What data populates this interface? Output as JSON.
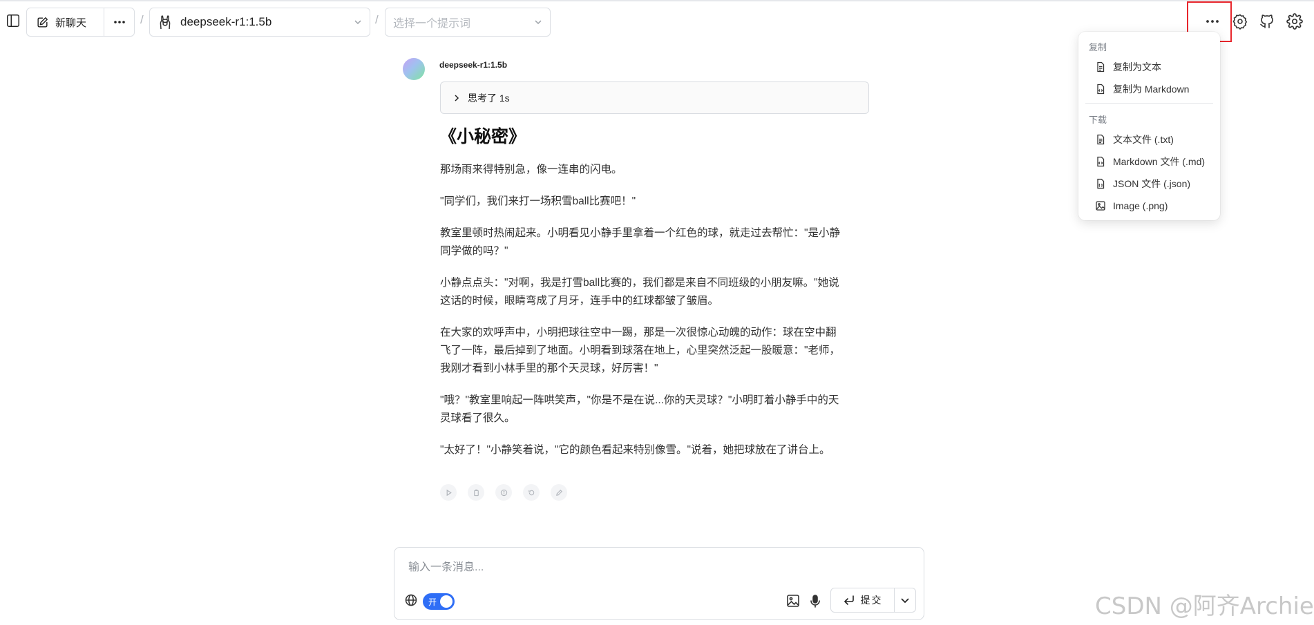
{
  "header": {
    "new_chat_label": "新聊天",
    "separator": "/",
    "model": "deepseek-r1:1.5b",
    "prompt_placeholder": "选择一个提示词"
  },
  "message": {
    "sender": "deepseek-r1:1.5b",
    "thinking_label": "思考了 1s",
    "title": "《小秘密》",
    "paragraphs": [
      "那场雨来得特别急，像一连串的闪电。",
      "\"同学们，我们来打一场积雪ball比赛吧！\"",
      "教室里顿时热闹起来。小明看见小静手里拿着一个红色的球，就走过去帮忙：\"是小静同学做的吗？\"",
      "小静点点头：\"对啊，我是打雪ball比赛的，我们都是来自不同班级的小朋友嘛。\"她说这话的时候，眼睛弯成了月牙，连手中的红球都皱了皱眉。",
      "在大家的欢呼声中，小明把球往空中一踢，那是一次很惊心动魄的动作：球在空中翻飞了一阵，最后掉到了地面。小明看到球落在地上，心里突然泛起一股暖意：\"老师，我刚才看到小林手里的那个天灵球，好厉害！\"",
      "\"哦？\"教室里响起一阵哄笑声，\"你是不是在说...你的天灵球？\"小明盯着小静手中的天灵球看了很久。",
      "\"太好了！\"小静笑着说，\"它的颜色看起来特别像雪。\"说着，她把球放在了讲台上。"
    ]
  },
  "menu": {
    "copy_header": "复制",
    "copy_items": [
      "复制为文本",
      "复制为 Markdown"
    ],
    "download_header": "下载",
    "download_items": [
      "文本文件 (.txt)",
      "Markdown 文件 (.md)",
      "JSON 文件 (.json)",
      "Image (.png)"
    ]
  },
  "composer": {
    "placeholder": "输入一条消息...",
    "toggle_label": "开",
    "submit_label": "提交"
  },
  "watermark": "CSDN @阿齐Archie",
  "colors": {
    "accent": "#2f6ef6",
    "highlight_box": "#e8262c"
  }
}
